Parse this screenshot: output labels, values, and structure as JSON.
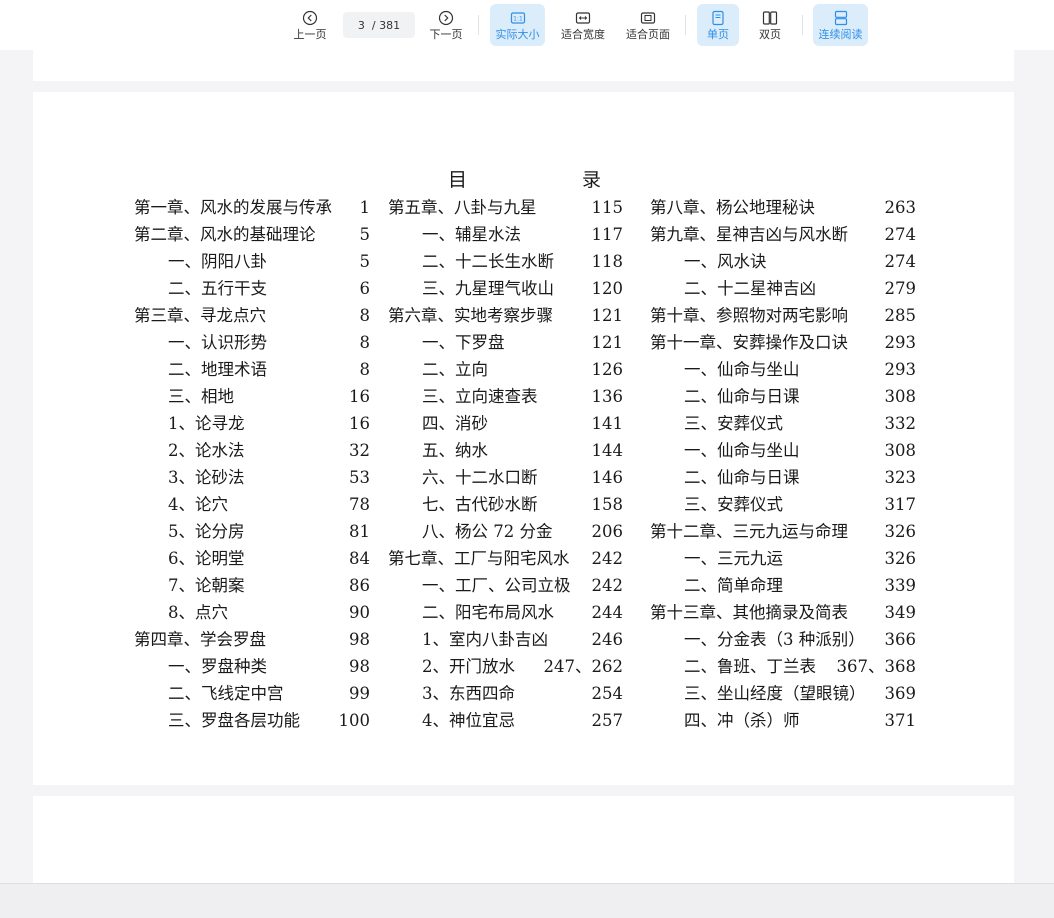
{
  "toolbar": {
    "prev_label": "上一页",
    "next_label": "下一页",
    "current_page": "3",
    "total_pages": "/ 381",
    "actual_size_label": "实际大小",
    "fit_width_label": "适合宽度",
    "fit_page_label": "适合页面",
    "single_page_label": "单页",
    "double_page_label": "双页",
    "continuous_label": "连续阅读",
    "accent_color": "#2f8fe6",
    "active_bg": "#dbecfb"
  },
  "toc": {
    "title_left": "目",
    "title_right": "录",
    "columns": [
      [
        {
          "text": "第一章、风水的发展与传承",
          "page": "1",
          "indent": 0
        },
        {
          "text": "第二章、风水的基础理论",
          "page": "5",
          "indent": 0
        },
        {
          "text": "一、阴阳八卦",
          "page": "5",
          "indent": 1
        },
        {
          "text": "二、五行干支",
          "page": "6",
          "indent": 1
        },
        {
          "text": "第三章、寻龙点穴",
          "page": "8",
          "indent": 0
        },
        {
          "text": "一、认识形势",
          "page": "8",
          "indent": 1
        },
        {
          "text": "二、地理术语",
          "page": "8",
          "indent": 1
        },
        {
          "text": "三、相地",
          "page": "16",
          "indent": 1
        },
        {
          "text": "1、论寻龙",
          "page": "16",
          "indent": 1
        },
        {
          "text": "2、论水法",
          "page": "32",
          "indent": 1
        },
        {
          "text": "3、论砂法",
          "page": "53",
          "indent": 1
        },
        {
          "text": "4、论穴",
          "page": "78",
          "indent": 1
        },
        {
          "text": "5、论分房",
          "page": "81",
          "indent": 1
        },
        {
          "text": "6、论明堂",
          "page": "84",
          "indent": 1
        },
        {
          "text": "7、论朝案",
          "page": "86",
          "indent": 1
        },
        {
          "text": "8、点穴",
          "page": "90",
          "indent": 1
        },
        {
          "text": "第四章、学会罗盘",
          "page": "98",
          "indent": 0
        },
        {
          "text": "一、罗盘种类",
          "page": "98",
          "indent": 1
        },
        {
          "text": "二、飞线定中宫",
          "page": "99",
          "indent": 1
        },
        {
          "text": "三、罗盘各层功能",
          "page": "100",
          "indent": 1
        }
      ],
      [
        {
          "text": "第五章、八卦与九星",
          "page": "115",
          "indent": 0
        },
        {
          "text": "一、辅星水法",
          "page": "117",
          "indent": 1
        },
        {
          "text": "二、十二长生水断",
          "page": "118",
          "indent": 1
        },
        {
          "text": "三、九星理气收山",
          "page": "120",
          "indent": 1
        },
        {
          "text": "第六章、实地考察步骤",
          "page": "121",
          "indent": 0
        },
        {
          "text": "一、下罗盘",
          "page": "121",
          "indent": 1
        },
        {
          "text": "二、立向",
          "page": "126",
          "indent": 1
        },
        {
          "text": "三、立向速查表",
          "page": "136",
          "indent": 1
        },
        {
          "text": "四、消砂",
          "page": "141",
          "indent": 1
        },
        {
          "text": "五、纳水",
          "page": "144",
          "indent": 1
        },
        {
          "text": "六、十二水口断",
          "page": "146",
          "indent": 1
        },
        {
          "text": "七、古代砂水断",
          "page": "158",
          "indent": 1
        },
        {
          "text": "八、杨公 72 分金",
          "page": "206",
          "indent": 1
        },
        {
          "text": "第七章、工厂与阳宅风水",
          "page": "242",
          "indent": 0
        },
        {
          "text": "一、工厂、公司立极",
          "page": "242",
          "indent": 1
        },
        {
          "text": "二、阳宅布局风水",
          "page": "244",
          "indent": 1
        },
        {
          "text": "1、室内八卦吉凶",
          "page": "246",
          "indent": 1
        },
        {
          "text": "2、开门放水",
          "page": "247、262",
          "indent": 1
        },
        {
          "text": "3、东西四命",
          "page": "254",
          "indent": 1
        },
        {
          "text": "4、神位宜忌",
          "page": "257",
          "indent": 1
        }
      ],
      [
        {
          "text": "第八章、杨公地理秘诀",
          "page": "263",
          "indent": 0
        },
        {
          "text": "第九章、星神吉凶与风水断",
          "page": "274",
          "indent": 0
        },
        {
          "text": "一、风水诀",
          "page": "274",
          "indent": 1
        },
        {
          "text": "二、十二星神吉凶",
          "page": "279",
          "indent": 1
        },
        {
          "text": "第十章、参照物对两宅影响",
          "page": "285",
          "indent": 0
        },
        {
          "text": "第十一章、安葬操作及口诀",
          "page": "293",
          "indent": 0
        },
        {
          "text": "一、仙命与坐山",
          "page": "293",
          "indent": 1
        },
        {
          "text": "二、仙命与日课",
          "page": "308",
          "indent": 1
        },
        {
          "text": "三、安葬仪式",
          "page": "332",
          "indent": 1
        },
        {
          "text": "一、仙命与坐山",
          "page": "308",
          "indent": 1
        },
        {
          "text": "二、仙命与日课",
          "page": "323",
          "indent": 1
        },
        {
          "text": "三、安葬仪式",
          "page": "317",
          "indent": 1
        },
        {
          "text": "第十二章、三元九运与命理",
          "page": "326",
          "indent": 0
        },
        {
          "text": "一、三元九运",
          "page": "326",
          "indent": 1
        },
        {
          "text": "二、简单命理",
          "page": "339",
          "indent": 1
        },
        {
          "text": "第十三章、其他摘录及简表",
          "page": "349",
          "indent": 0
        },
        {
          "text": "一、分金表（3 种派别）",
          "page": "366",
          "indent": 1
        },
        {
          "text": "二、鲁班、丁兰表",
          "page": "367、368",
          "indent": 1
        },
        {
          "text": "三、坐山经度（望眼镜）",
          "page": "369",
          "indent": 1
        },
        {
          "text": "四、冲（杀）师",
          "page": "371",
          "indent": 1
        }
      ]
    ]
  }
}
